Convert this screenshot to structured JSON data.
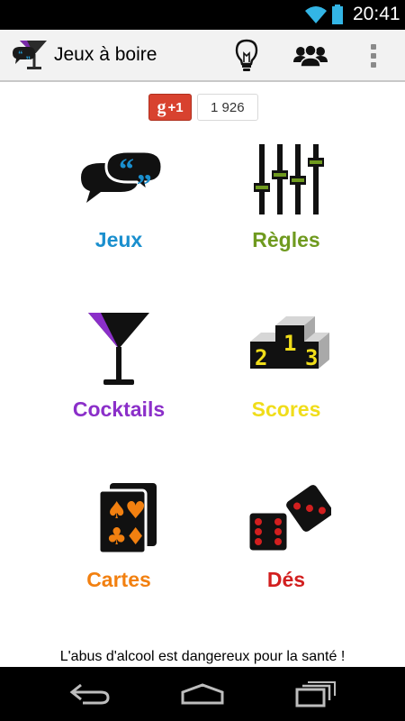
{
  "status_bar": {
    "time": "20:41"
  },
  "app": {
    "title": "Jeux à boire"
  },
  "action_bar": {
    "icons": [
      "lightbulb-icon",
      "group-icon",
      "overflow-menu-icon"
    ]
  },
  "gplus": {
    "label": "+1",
    "g": "g",
    "count": "1 926"
  },
  "tiles": [
    {
      "label": "Jeux",
      "icon": "speech-bubbles-icon",
      "color": "#1a8fce"
    },
    {
      "label": "Règles",
      "icon": "sliders-icon",
      "color": "#6f9a1f"
    },
    {
      "label": "Cocktails",
      "icon": "cocktail-glass-icon",
      "color": "#8b2fc9"
    },
    {
      "label": "Scores",
      "icon": "podium-icon",
      "color": "#f0dd1a"
    },
    {
      "label": "Cartes",
      "icon": "playing-cards-icon",
      "color": "#f28010"
    },
    {
      "label": "Dés",
      "icon": "dice-icon",
      "color": "#d21f1f"
    }
  ],
  "warning": "L'abus d'alcool est dangereux pour la santé !",
  "nav": [
    "back-icon",
    "home-icon",
    "recent-apps-icon"
  ]
}
